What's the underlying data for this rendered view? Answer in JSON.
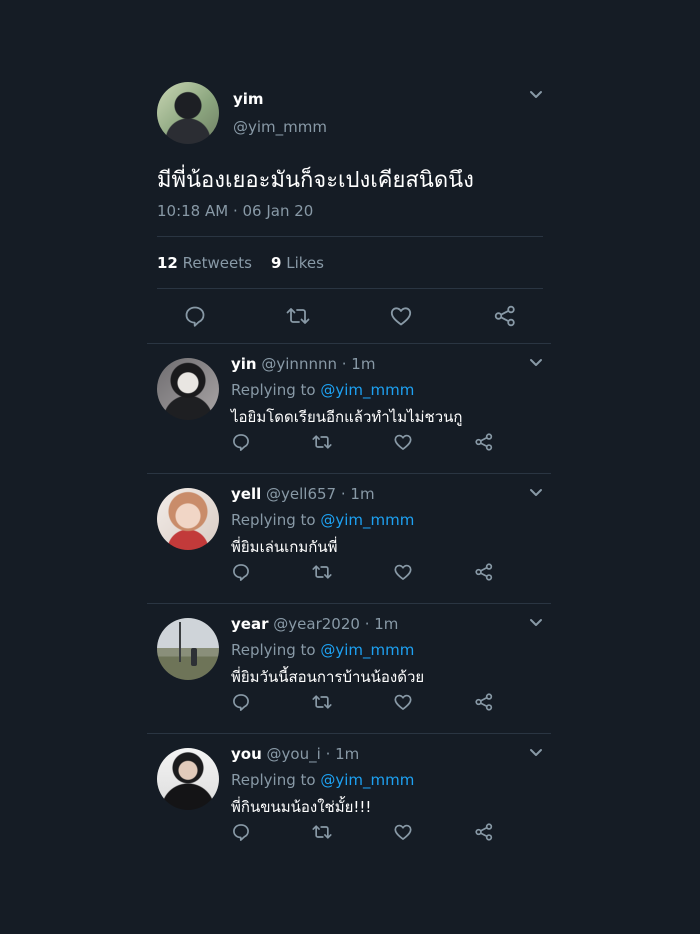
{
  "main_tweet": {
    "name": "yim",
    "handle": "@yim_mmm",
    "text": "มีพี่น้องเยอะมันก็จะเปงเคียสนิดนึง",
    "time": "10:18 AM · 06 Jan 20",
    "retweets_count": "12",
    "retweets_label": "Retweets",
    "likes_count": "9",
    "likes_label": "Likes"
  },
  "replies": [
    {
      "name": "yin",
      "handle": "@yinnnnn",
      "time": "· 1m",
      "replying_label": "Replying to",
      "replying_to": "@yim_mmm",
      "text": "ไอยิมโดดเรียนอีกแล้วทำไมไม่ชวนกู"
    },
    {
      "name": "yell",
      "handle": "@yell657",
      "time": "· 1m",
      "replying_label": "Replying to",
      "replying_to": "@yim_mmm",
      "text": "พี่ยิมเล่นเกมกันพี่"
    },
    {
      "name": "year",
      "handle": "@year2020",
      "time": "· 1m",
      "replying_label": "Replying to",
      "replying_to": "@yim_mmm",
      "text": "พี่ยิมวันนี้สอนการบ้านน้องด้วย"
    },
    {
      "name": "you",
      "handle": "@you_i",
      "time": "· 1m",
      "replying_label": "Replying to",
      "replying_to": "@yim_mmm",
      "text": "พี่กินขนมน้องใช่มั้ย!!!"
    }
  ],
  "icons": [
    "reply-icon",
    "retweet-icon",
    "like-icon",
    "share-icon",
    "chevron-down-icon"
  ],
  "colors": {
    "background": "#151c25",
    "text": "#ffffff",
    "secondary": "#8899a6",
    "accent": "#1da1f2",
    "divider": "#2a3542"
  }
}
